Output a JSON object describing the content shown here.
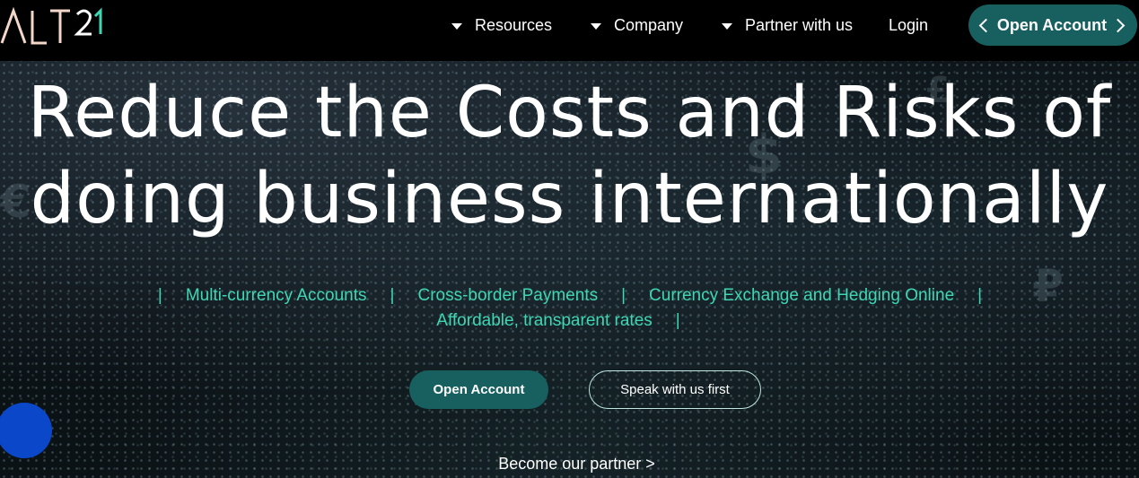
{
  "brand": {
    "logo_text": "ALT21"
  },
  "nav": {
    "items": [
      {
        "label": "Resources",
        "has_caret": true
      },
      {
        "label": "Company",
        "has_caret": true
      },
      {
        "label": "Partner with us",
        "has_caret": true
      },
      {
        "label": "Login",
        "has_caret": false
      }
    ],
    "cta": "Open Account"
  },
  "hero": {
    "headline_line1": "Reduce the Costs and Risks of",
    "headline_line2": "doing business internationally",
    "features": [
      "Multi-currency Accounts",
      "Cross-border Payments",
      "Currency Exchange and Hedging Online",
      "Affordable, transparent rates"
    ],
    "separator": "|",
    "primary_button": "Open Account",
    "secondary_button": "Speak with us first",
    "partner_link": "Become our partner >"
  },
  "colors": {
    "accent_teal": "#17605f",
    "feature_text": "#3fd6b4",
    "header_bg": "#000000",
    "chat_blue": "#0a47c9"
  }
}
